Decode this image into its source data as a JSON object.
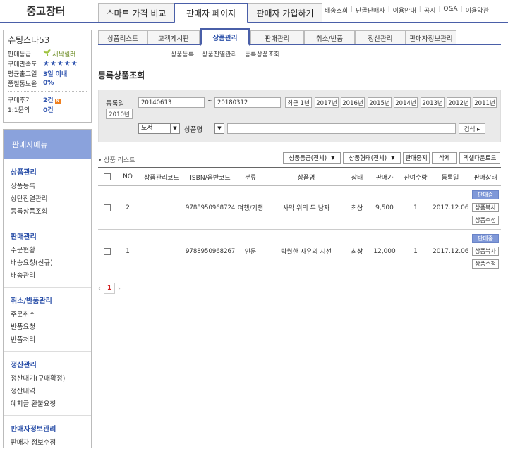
{
  "brand": "중고장터",
  "top_tabs": [
    "스마트 가격 비교",
    "판매자 페이지",
    "판매자 가입하기"
  ],
  "top_links": [
    "배송조회",
    "단골판매자",
    "이용안내",
    "공지",
    "Q&A",
    "이용약관"
  ],
  "profile": {
    "name": "슈팅스타53",
    "grade_label": "판매등급",
    "grade_value": "새싹셀러",
    "satisfaction_label": "구매만족도",
    "stars": "★★★★★",
    "ship_label": "평균출고일",
    "ship_value": "3일 이내",
    "soldout_label": "품절통보율",
    "soldout_value": "0%",
    "review_label": "구매후기",
    "review_value": "2건",
    "review_new": "N",
    "inquiry_label": "1:1문의",
    "inquiry_value": "0건"
  },
  "menu": {
    "title": "판매자메뉴",
    "groups": [
      {
        "title": "상품관리",
        "items": [
          "상품등록",
          "상단진열관리",
          "등록상품조회"
        ]
      },
      {
        "title": "판매관리",
        "items": [
          "주문현황",
          "배송요청(신규)",
          "배송관리"
        ]
      },
      {
        "title": "취소/반품관리",
        "items": [
          "주문취소",
          "반품요청",
          "반품처리"
        ]
      },
      {
        "title": "정산관리",
        "items": [
          "정산대기(구매확정)",
          "정산내역",
          "예치금 환불요청"
        ]
      },
      {
        "title": "판매자정보관리",
        "items": [
          "판매자 정보수정"
        ]
      }
    ]
  },
  "sub_tabs": [
    "상품리스트",
    "고객게시판",
    "상품관리",
    "판매관리",
    "취소/반품",
    "정산관리",
    "판매자정보관리"
  ],
  "breadcrumb": [
    "상품등록",
    "상품진열관리",
    "등록상품조회"
  ],
  "page_title": "등록상품조회",
  "search": {
    "date_label": "등록일",
    "date_from": "20140613",
    "tilde": "~",
    "date_to": "20180312",
    "years": [
      "최근 1년",
      "2017년",
      "2016년",
      "2015년",
      "2014년",
      "2013년",
      "2012년",
      "2011년",
      "2010년"
    ],
    "category_select": "도서",
    "field_select": "상품명",
    "keyword": "",
    "search_btn": "검색 ▸"
  },
  "list": {
    "label": "• 상품 리스트",
    "grade_filter": "상품등급(전체)",
    "status_filter": "상품형태(전체)",
    "stop_btn": "판매중지",
    "delete_btn": "삭제",
    "excel_btn": "엑셀다운로드",
    "headers": [
      "NO",
      "상품관리코드",
      "ISBN/음반코드",
      "분류",
      "상품명",
      "상태",
      "판매가",
      "잔여수량",
      "등록일",
      "판매상태"
    ],
    "rows": [
      {
        "no": "2",
        "code": "",
        "isbn": "9788950968724",
        "category": "여행/기행",
        "title": "사막 위의 두 남자",
        "condition": "최상",
        "price": "9,500",
        "qty": "1",
        "date": "2017.12.06",
        "status": "판매중",
        "copy": "상품복사",
        "edit": "상품수정"
      },
      {
        "no": "1",
        "code": "",
        "isbn": "9788950968267",
        "category": "인문",
        "title": "탁월한 사유의 시선",
        "condition": "최상",
        "price": "12,000",
        "qty": "1",
        "date": "2017.12.06",
        "status": "판매중",
        "copy": "상품복사",
        "edit": "상품수정"
      }
    ]
  },
  "pager": {
    "prev": "‹",
    "current": "1",
    "next": "›"
  }
}
